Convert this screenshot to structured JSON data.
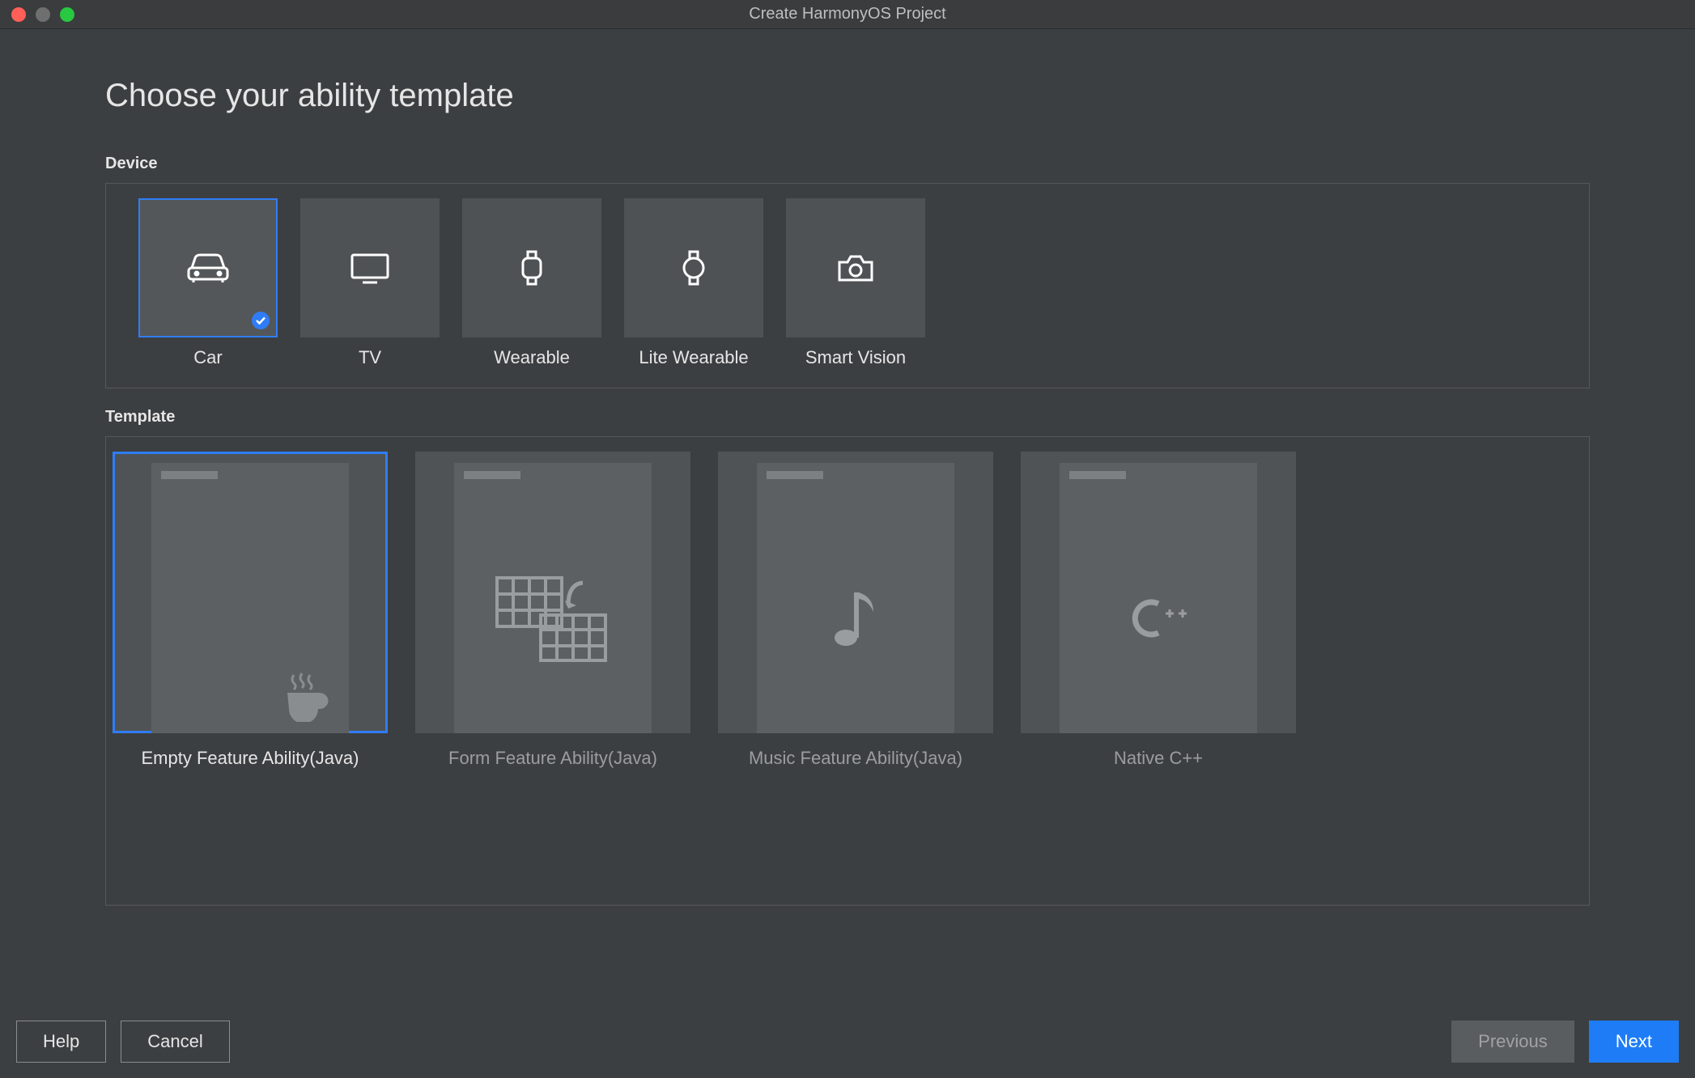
{
  "window": {
    "title": "Create HarmonyOS Project"
  },
  "page": {
    "heading": "Choose your ability template"
  },
  "device_section": {
    "label": "Device",
    "items": [
      {
        "id": "car",
        "label": "Car",
        "selected": true
      },
      {
        "id": "tv",
        "label": "TV",
        "selected": false
      },
      {
        "id": "wearable",
        "label": "Wearable",
        "selected": false
      },
      {
        "id": "lite-wearable",
        "label": "Lite Wearable",
        "selected": false
      },
      {
        "id": "smart-vision",
        "label": "Smart Vision",
        "selected": false
      }
    ]
  },
  "template_section": {
    "label": "Template",
    "items": [
      {
        "id": "empty-feature-java",
        "label": "Empty Feature Ability(Java)",
        "selected": true
      },
      {
        "id": "form-feature-java",
        "label": "Form Feature Ability(Java)",
        "selected": false
      },
      {
        "id": "music-feature-java",
        "label": "Music Feature Ability(Java)",
        "selected": false
      },
      {
        "id": "native-cpp",
        "label": "Native C++",
        "selected": false
      }
    ]
  },
  "footer": {
    "help": "Help",
    "cancel": "Cancel",
    "previous": "Previous",
    "next": "Next"
  }
}
